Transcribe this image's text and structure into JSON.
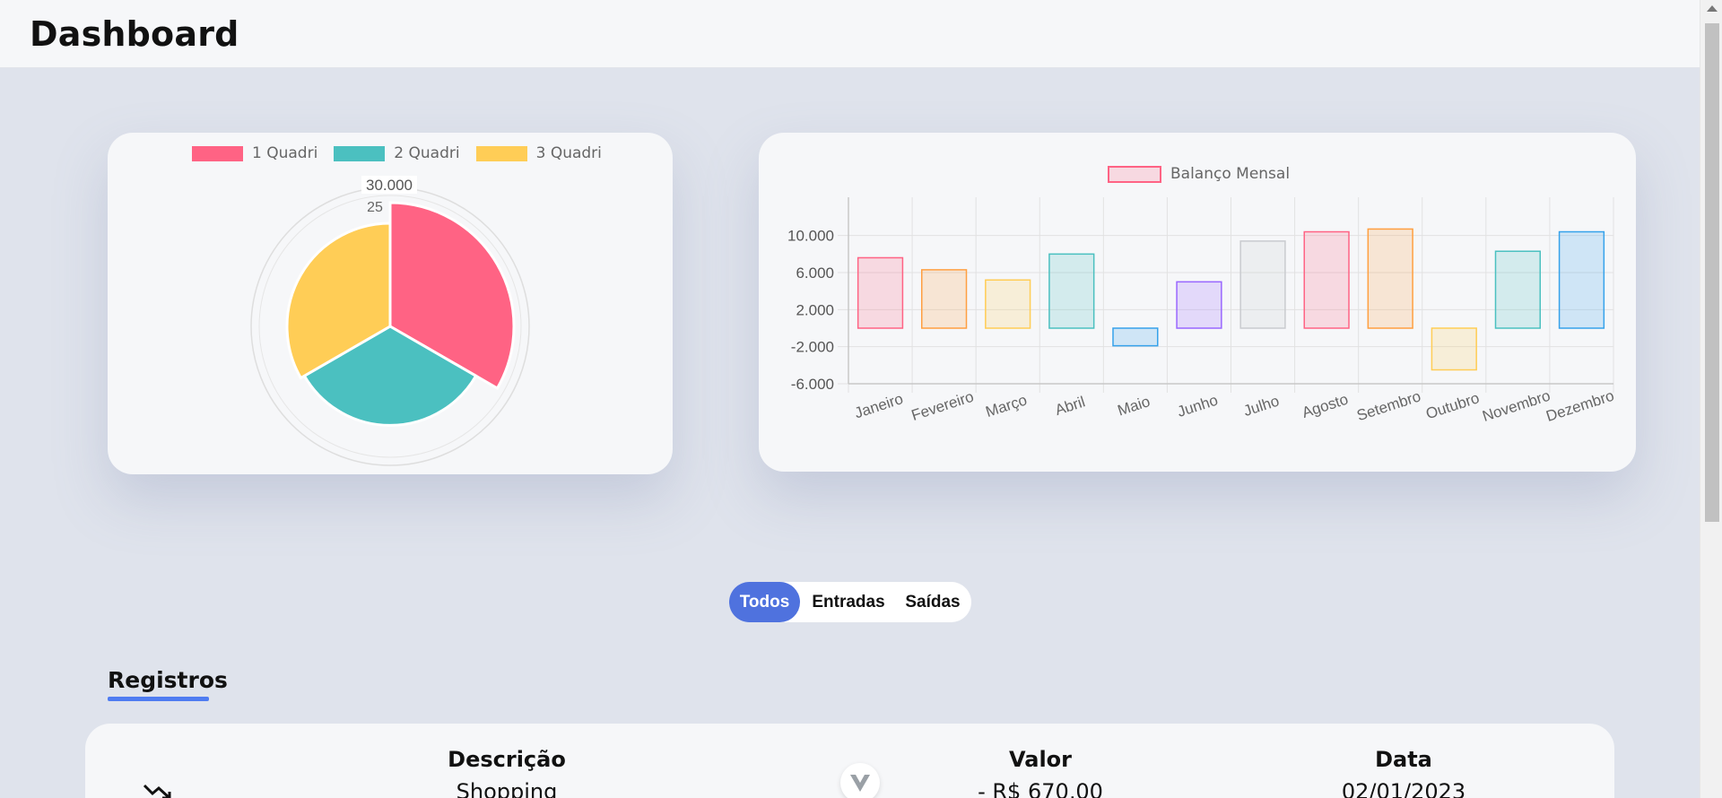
{
  "header": {
    "title": "Dashboard"
  },
  "pie_chart": {
    "chart_data": {
      "type": "pie",
      "variant": "polar-area",
      "categories": [
        "1 Quadri",
        "2 Quadri",
        "3 Quadri"
      ],
      "values": [
        30000,
        24000,
        25000
      ],
      "colors": [
        "#ff6384",
        "#4bc0c0",
        "#ffcd56"
      ],
      "tick_labels": [
        "30.000",
        "25"
      ],
      "legend_position": "top"
    }
  },
  "bar_chart": {
    "chart_data": {
      "type": "bar",
      "title": "",
      "series": [
        {
          "name": "Balanço Mensal",
          "values": [
            7600,
            6300,
            5200,
            8000,
            -1900,
            5000,
            9400,
            10400,
            10700,
            -4500,
            8300,
            10400
          ]
        }
      ],
      "categories": [
        "Janeiro",
        "Fevereiro",
        "Março",
        "Abril",
        "Maio",
        "Junho",
        "Julho",
        "Agosto",
        "Setembro",
        "Outubro",
        "Novembro",
        "Dezembro"
      ],
      "colors": [
        "#ff6384",
        "#ff9f40",
        "#ffcd56",
        "#4bc0c0",
        "#36a2eb",
        "#9966ff",
        "#c9cbcf",
        "#ff6384",
        "#ff9f40",
        "#ffcd56",
        "#4bc0c0",
        "#36a2eb"
      ],
      "ylim": [
        -6000,
        12000
      ],
      "yticks": [
        10000,
        6000,
        2000,
        -2000,
        -6000
      ],
      "ytick_labels": [
        "10.000",
        "6.000",
        "2.000",
        "-2.000",
        "-6.000"
      ],
      "grid": true,
      "legend_position": "top"
    }
  },
  "filters": {
    "items": [
      "Todos",
      "Entradas",
      "Saídas"
    ],
    "active": "Todos"
  },
  "registros": {
    "title": "Registros",
    "columns": [
      "Descrição",
      "Valor",
      "Data"
    ],
    "rows": [
      {
        "descricao": "Shopping",
        "valor": "- R$ 670,00",
        "data": "02/01/2023"
      }
    ]
  }
}
